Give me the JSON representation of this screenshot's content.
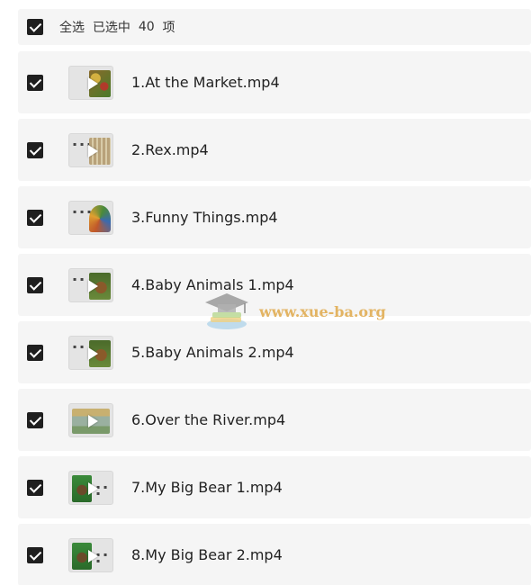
{
  "header": {
    "select_all_label": "全选",
    "selected_prefix": "已选中",
    "selected_count": "40",
    "selected_suffix": "项"
  },
  "files": [
    {
      "name": "1.At the Market.mp4",
      "checked": true,
      "thumb_color": "#8a6a2a",
      "thumb_accent": "#c9a13a"
    },
    {
      "name": "2.Rex.mp4",
      "checked": true,
      "thumb_color": "#b8a27a",
      "thumb_accent": "#7a9a4a"
    },
    {
      "name": "3.Funny Things.mp4",
      "checked": true,
      "thumb_color": "#c0582a",
      "thumb_accent": "#4a8a3a"
    },
    {
      "name": "4.Baby Animals 1.mp4",
      "checked": true,
      "thumb_color": "#4a6a2a",
      "thumb_accent": "#8a5a2a"
    },
    {
      "name": "5.Baby Animals 2.mp4",
      "checked": true,
      "thumb_color": "#4a6a2a",
      "thumb_accent": "#8a5a2a"
    },
    {
      "name": "6.Over the River.mp4",
      "checked": true,
      "thumb_color": "#9ab0a0",
      "thumb_accent": "#c8b070"
    },
    {
      "name": "7.My Big Bear 1.mp4",
      "checked": true,
      "thumb_color": "#3a8a3a",
      "thumb_accent": "#6a4a2a"
    },
    {
      "name": "8.My Big Bear 2.mp4",
      "checked": true,
      "thumb_color": "#3a8a3a",
      "thumb_accent": "#6a4a2a"
    }
  ],
  "watermark": {
    "text": "www.xue-ba.org"
  },
  "colors": {
    "checkbox": "#1f1f1f",
    "row_background": "#f5f5f5",
    "watermark": "#e0a94a"
  }
}
